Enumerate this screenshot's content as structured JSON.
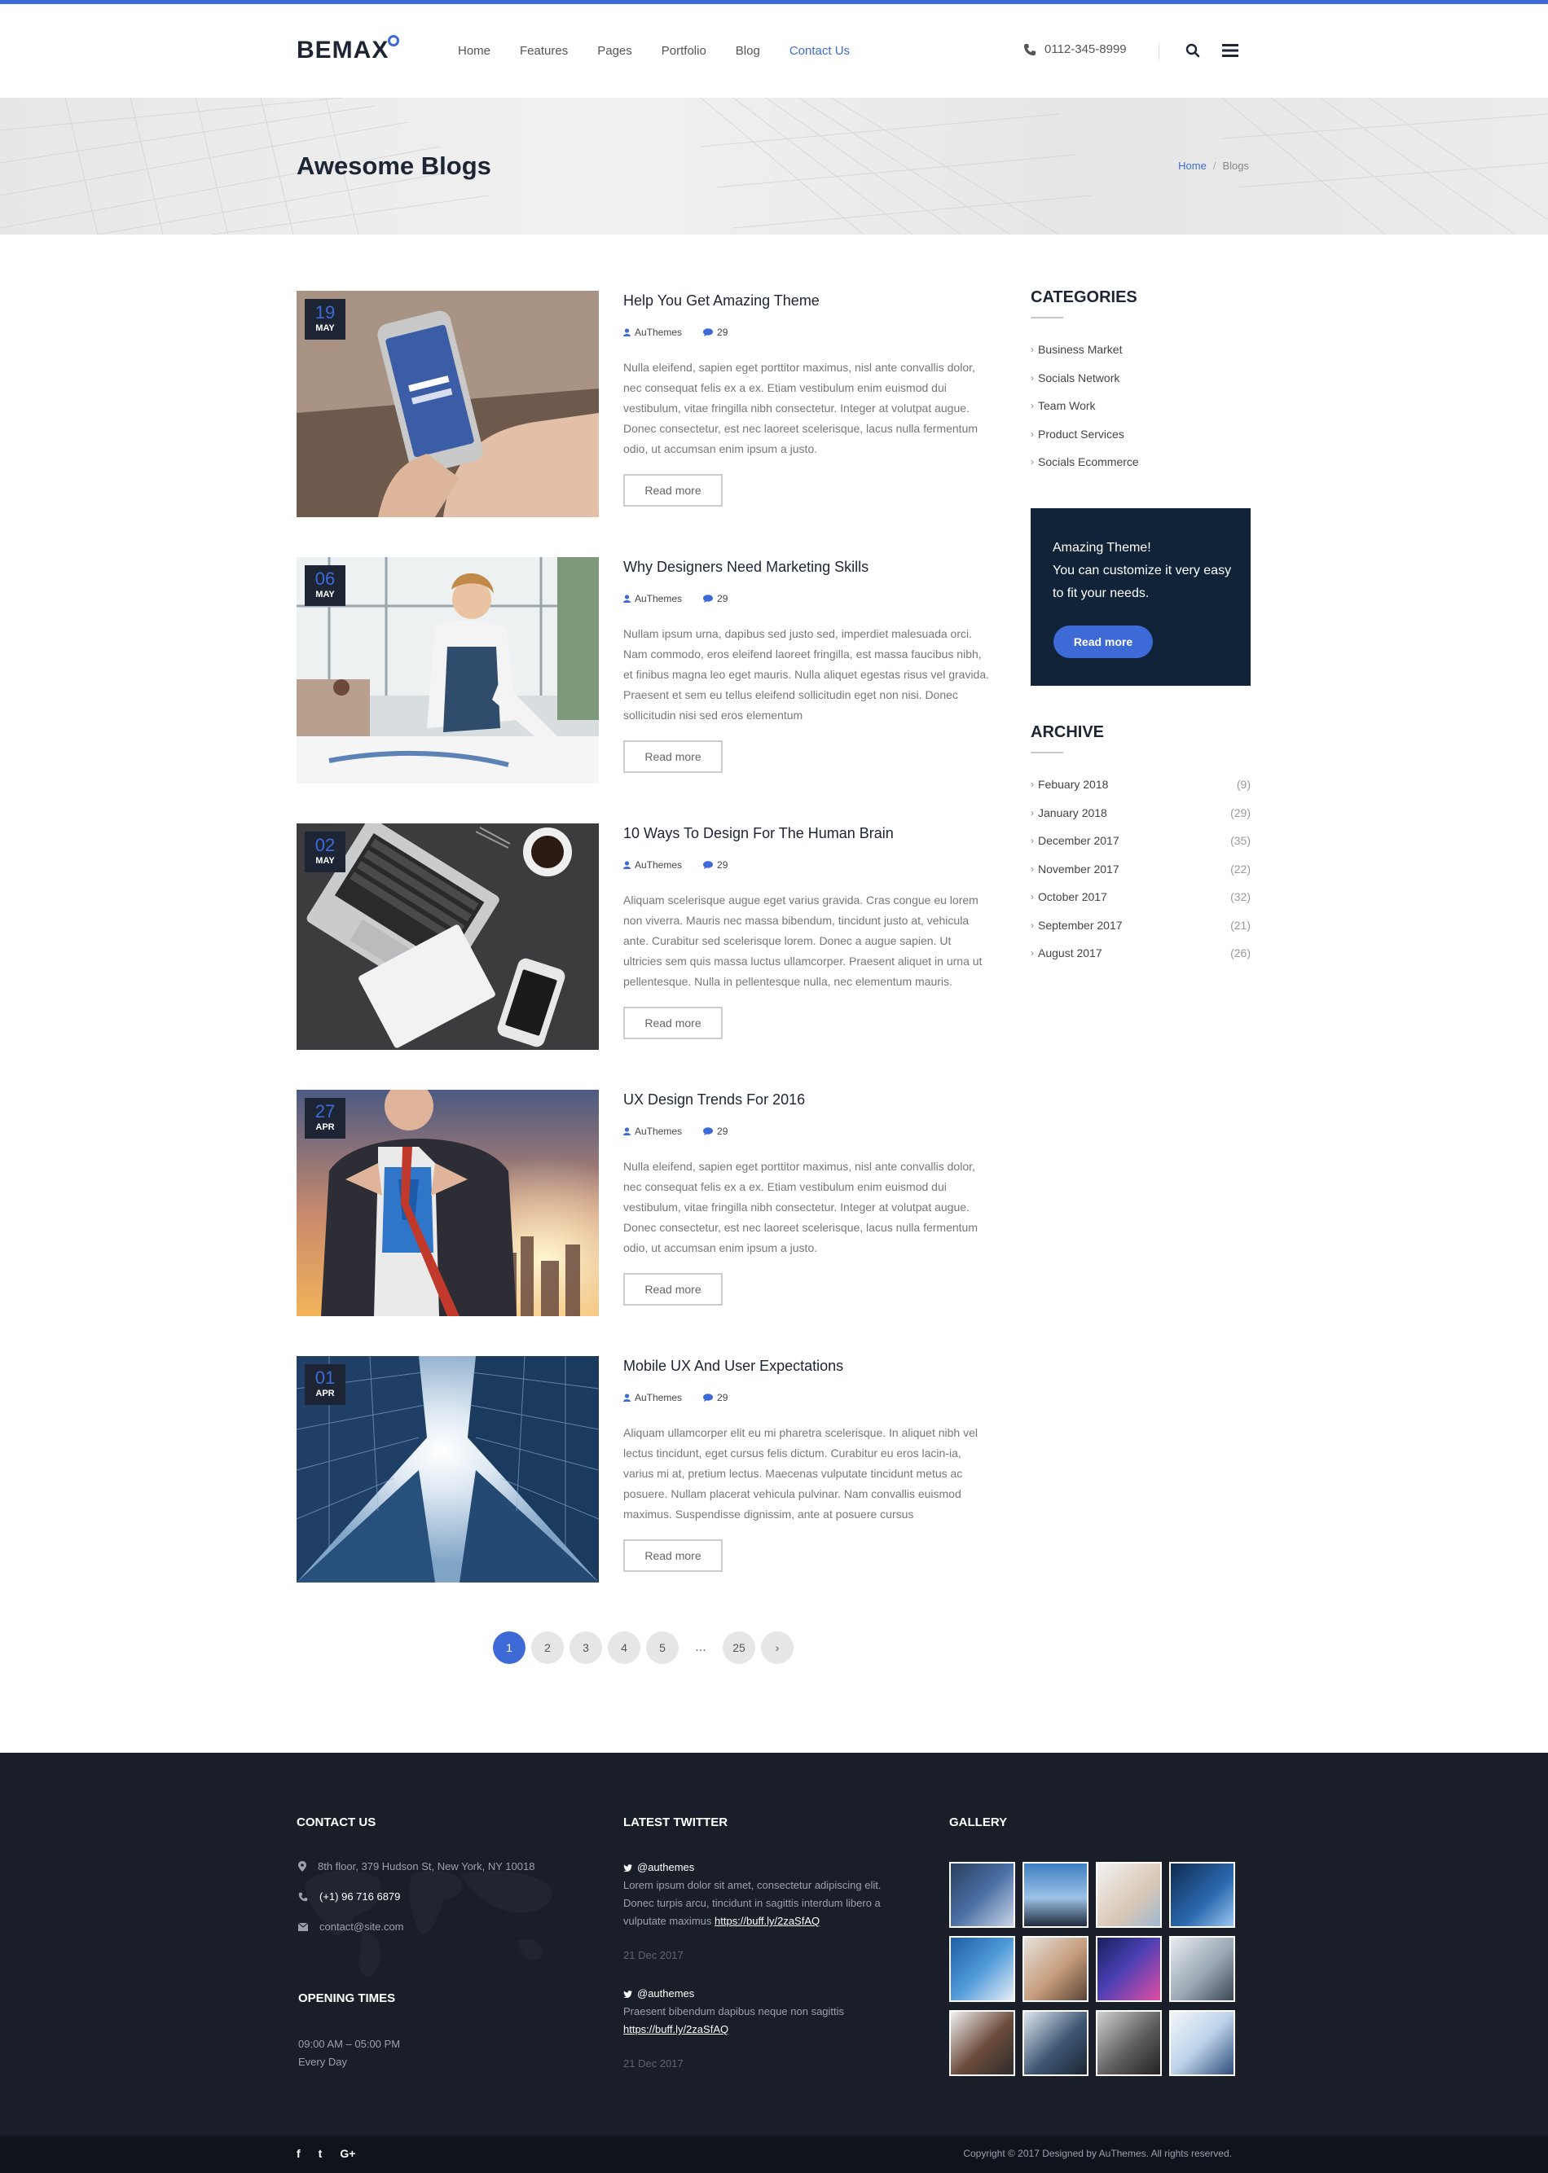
{
  "brand": {
    "name": "BEMAX",
    "accent": "#3d6ad6",
    "dark": "#1d2433"
  },
  "nav": [
    "Home",
    "Features",
    "Pages",
    "Portfolio",
    "Blog",
    "Contact Us"
  ],
  "header": {
    "phone": "0112-345-8999"
  },
  "page": {
    "title": "Awesome Blogs",
    "breadcrumb_home": "Home",
    "breadcrumb_current": "Blogs"
  },
  "posts": [
    {
      "day": "19",
      "month": "MAY",
      "title": "Help You Get Amazing Theme",
      "author": "AuThemes",
      "comments": "29",
      "excerpt": "Nulla eleifend, sapien eget porttitor maximus, nisl ante convallis dolor, nec consequat felis ex a ex. Etiam vestibulum enim euismod dui vestibulum, vitae fringilla nibh consectetur. Integer at volutpat augue. Donec consectetur, est nec laoreet scelerisque, lacus nulla fermentum odio, ut accumsan enim ipsum a justo.",
      "read_more": "Read more",
      "image": "hand-holding-phone"
    },
    {
      "day": "06",
      "month": "MAY",
      "title": "Why Designers Need Marketing Skills",
      "author": "AuThemes",
      "comments": "29",
      "excerpt": "Nullam ipsum urna, dapibus sed justo sed, imperdiet malesuada orci. Nam commodo, eros eleifend laoreet fringilla, est massa faucibus nibh, et finibus magna leo eget mauris. Nulla aliquet egestas risus vel gravida. Praesent et sem eu tellus eleifend sollicitudin eget non nisi. Donec sollicitudin nisi sed eros elementum",
      "read_more": "Read more",
      "image": "woman-designer-office"
    },
    {
      "day": "02",
      "month": "MAY",
      "title": "10 Ways To Design For The Human Brain",
      "author": "AuThemes",
      "comments": "29",
      "excerpt": "Aliquam scelerisque augue eget varius gravida. Cras congue eu lorem non viverra. Mauris nec massa bibendum, tincidunt justo at, vehicula ante. Curabitur sed scelerisque lorem. Donec a augue sapien. Ut ultricies sem quis massa luctus ullamcorper. Praesent aliquet in urna ut pellentesque. Nulla in pellentesque nulla, nec elementum mauris.",
      "read_more": "Read more",
      "image": "laptop-desk-coffee"
    },
    {
      "day": "27",
      "month": "APR",
      "title": "UX Design Trends For 2016",
      "author": "AuThemes",
      "comments": "29",
      "excerpt": "Nulla eleifend, sapien eget porttitor maximus, nisl ante convallis dolor, nec consequat felis ex a ex. Etiam vestibulum enim euismod dui vestibulum, vitae fringilla nibh consectetur. Integer at volutpat augue. Donec consectetur, est nec laoreet scelerisque, lacus nulla fermentum odio, ut accumsan enim ipsum a justo.",
      "read_more": "Read more",
      "image": "businessman-superhero"
    },
    {
      "day": "01",
      "month": "APR",
      "title": "Mobile UX And User Expectations",
      "author": "AuThemes",
      "comments": "29",
      "excerpt": "Aliquam ullamcorper elit eu mi pharetra scelerisque. In aliquet nibh vel lectus tincidunt, eget cursus felis dictum. Curabitur eu eros lacin-ia, varius mi at, pretium lectus. Maecenas vulputate tincidunt metus ac posuere. Nullam placerat vehicula pulvinar. Nam convallis euismod maximus. Suspendisse dignissim, ante at posuere cursus",
      "read_more": "Read more",
      "image": "skyscrapers-sky"
    }
  ],
  "sidebar": {
    "categories_title": "CATEGORIES",
    "categories": [
      "Business Market",
      "Socials Network",
      "Team Work",
      "Product Services",
      "Socials Ecommerce"
    ],
    "promo": {
      "text": "Amazing Theme!\nYou can customize it very easy to fit your needs.",
      "button": "Read more"
    },
    "archive_title": "ARCHIVE",
    "archive": [
      {
        "label": "Febuary 2018",
        "count": "(9)"
      },
      {
        "label": "January 2018",
        "count": "(29)"
      },
      {
        "label": "December 2017",
        "count": "(35)"
      },
      {
        "label": "November 2017",
        "count": "(22)"
      },
      {
        "label": "October 2017",
        "count": "(32)"
      },
      {
        "label": "September 2017",
        "count": "(21)"
      },
      {
        "label": "August 2017",
        "count": "(26)"
      }
    ]
  },
  "pagination": {
    "pages": [
      "1",
      "2",
      "3",
      "4",
      "5"
    ],
    "ellipsis": "...",
    "last": "25",
    "next": "›",
    "current": "1"
  },
  "footer": {
    "contact_title": "CONTACT US",
    "address": "8th floor, 379 Hudson St, New York, NY 10018",
    "phone": "(+1) 96 716 6879",
    "email": "contact@site.com",
    "hours_title": "OPENING TIMES",
    "hours": "09:00 AM – 05:00 PM",
    "days": "Every Day",
    "twitter_title": "LATEST TWITTER",
    "tweets": [
      {
        "handle": "@authemes",
        "text": "Lorem ipsum dolor sit amet, consectetur adipiscing elit. Donec turpis arcu, tincidunt in sagittis interdum libero a vulputate maximus",
        "link": "https://buff.ly/2zaSfAQ",
        "date": "21 Dec 2017"
      },
      {
        "handle": "@authemes",
        "text": "Praesent bibendum dapibus neque non sagittis",
        "link": "https://buff.ly/2zaSfAQ",
        "date": "21 Dec 2017"
      }
    ],
    "gallery_title": "GALLERY",
    "social": [
      "f",
      "t",
      "G+"
    ],
    "copyright": "Copyright © 2017 Designed by AuThemes. All rights reserved."
  }
}
